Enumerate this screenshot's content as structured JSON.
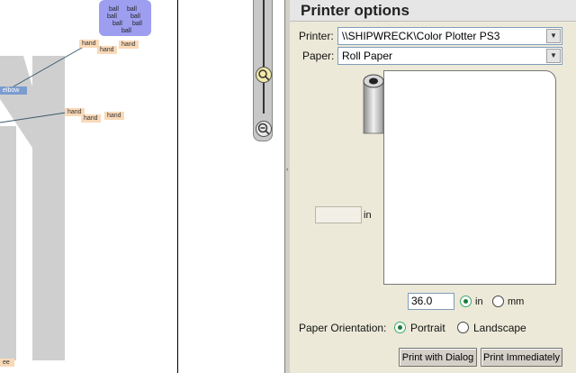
{
  "canvas": {
    "nodes": {
      "ball_1": "ball",
      "ball_2": "ball",
      "ball_3": "ball",
      "ball_4": "ball",
      "ball_5": "ball",
      "ball_6": "ball",
      "ball_7": "ball",
      "hand_1": "hand",
      "hand_2": "hand",
      "hand_3": "hand",
      "hand_4": "hand",
      "hand_5": "hand",
      "hand_6": "hand",
      "elbow": "elbow",
      "partial_bottom": "ee"
    }
  },
  "zoom": {
    "zoom_in_icon": "zoom-in-icon",
    "zoom_out_icon": "zoom-out-icon"
  },
  "panel": {
    "title": "Printer options",
    "printer_label": "Printer:",
    "printer_value": "\\\\SHIPWRECK\\Color Plotter PS3",
    "paper_label": "Paper:",
    "paper_value": "Roll Paper",
    "width_value": "",
    "width_unit": "in",
    "length_value": "36.0",
    "unit_in": "in",
    "unit_mm": "mm",
    "orientation_label": "Paper Orientation:",
    "portrait": "Portrait",
    "landscape": "Landscape",
    "print_dialog": "Print with Dialog",
    "print_immediately": "Print Immediately"
  },
  "colors": {
    "panel_bg": "#ece9d8",
    "hand_node": "#f9d9b8",
    "ball_node": "#9e9ef0",
    "elbow_node": "#7b9ccf",
    "radio_selected": "#1a7a3a"
  }
}
